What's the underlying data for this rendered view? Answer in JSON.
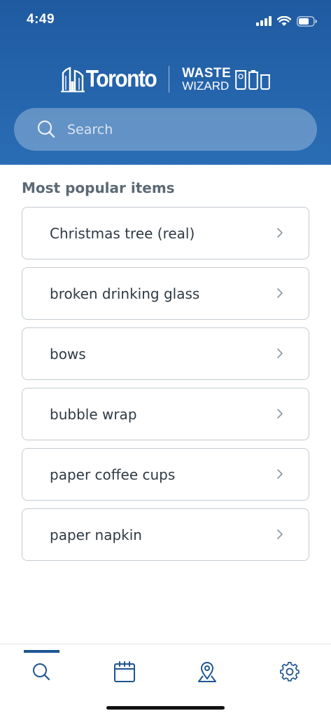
{
  "status_bar": {
    "time": "4:49"
  },
  "header": {
    "brand_city": "Toronto",
    "app_name_line1": "WASTE",
    "app_name_line2": "WIZARD"
  },
  "search": {
    "placeholder": "Search",
    "value": ""
  },
  "popular": {
    "title": "Most popular items",
    "items": [
      {
        "label": "Christmas tree (real)"
      },
      {
        "label": "broken drinking glass"
      },
      {
        "label": "bows"
      },
      {
        "label": "bubble wrap"
      },
      {
        "label": "paper coffee cups"
      },
      {
        "label": "paper napkin"
      }
    ]
  },
  "tabs": [
    {
      "icon": "search-icon",
      "active": true
    },
    {
      "icon": "calendar-icon",
      "active": false
    },
    {
      "icon": "location-pin-icon",
      "active": false
    },
    {
      "icon": "gear-icon",
      "active": false
    }
  ],
  "colors": {
    "header_blue": "#1f5aa0",
    "accent_blue": "#1d5592",
    "text_dark": "#2f3a44",
    "text_muted": "#5b6975",
    "border": "#c3cbd1"
  }
}
